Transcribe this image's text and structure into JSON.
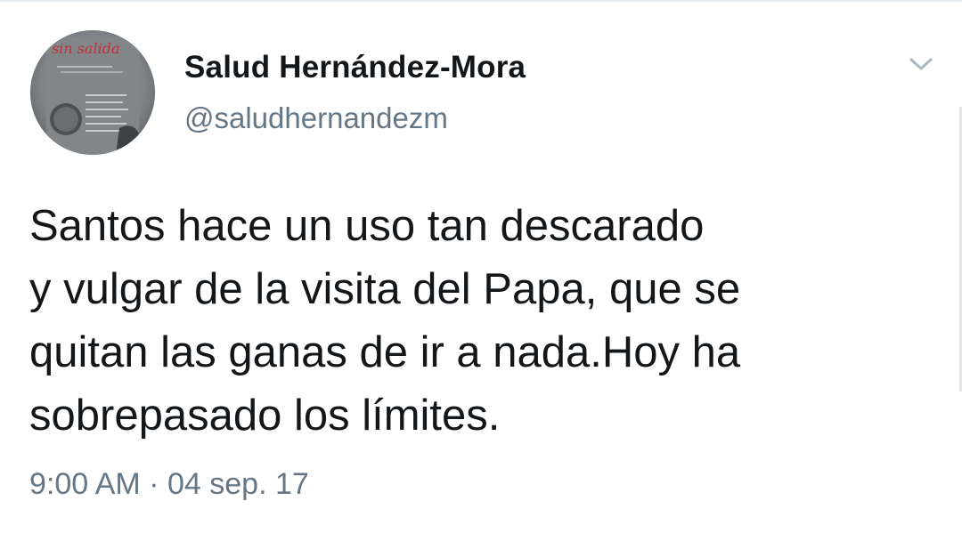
{
  "author": {
    "name": "Salud Hernández-Mora",
    "handle": "@saludhernandezm",
    "avatar_icon": "book-cover-avatar-icon",
    "avatar_title": "sin salida"
  },
  "tweet": {
    "lines": [
      "Santos hace un uso tan descarado",
      "y vulgar de la visita del Papa, que se",
      "quitan las ganas de ir a nada.Hoy ha",
      "sobrepasado los límites."
    ],
    "time": "9:00 AM",
    "separator": "·",
    "date": "04 sep. 17"
  },
  "menu": {
    "caret_icon": "chevron-down-icon"
  },
  "colors": {
    "text": "#14171a",
    "secondary": "#657786",
    "caret": "#aab8c2",
    "border": "#e6ecf0"
  }
}
